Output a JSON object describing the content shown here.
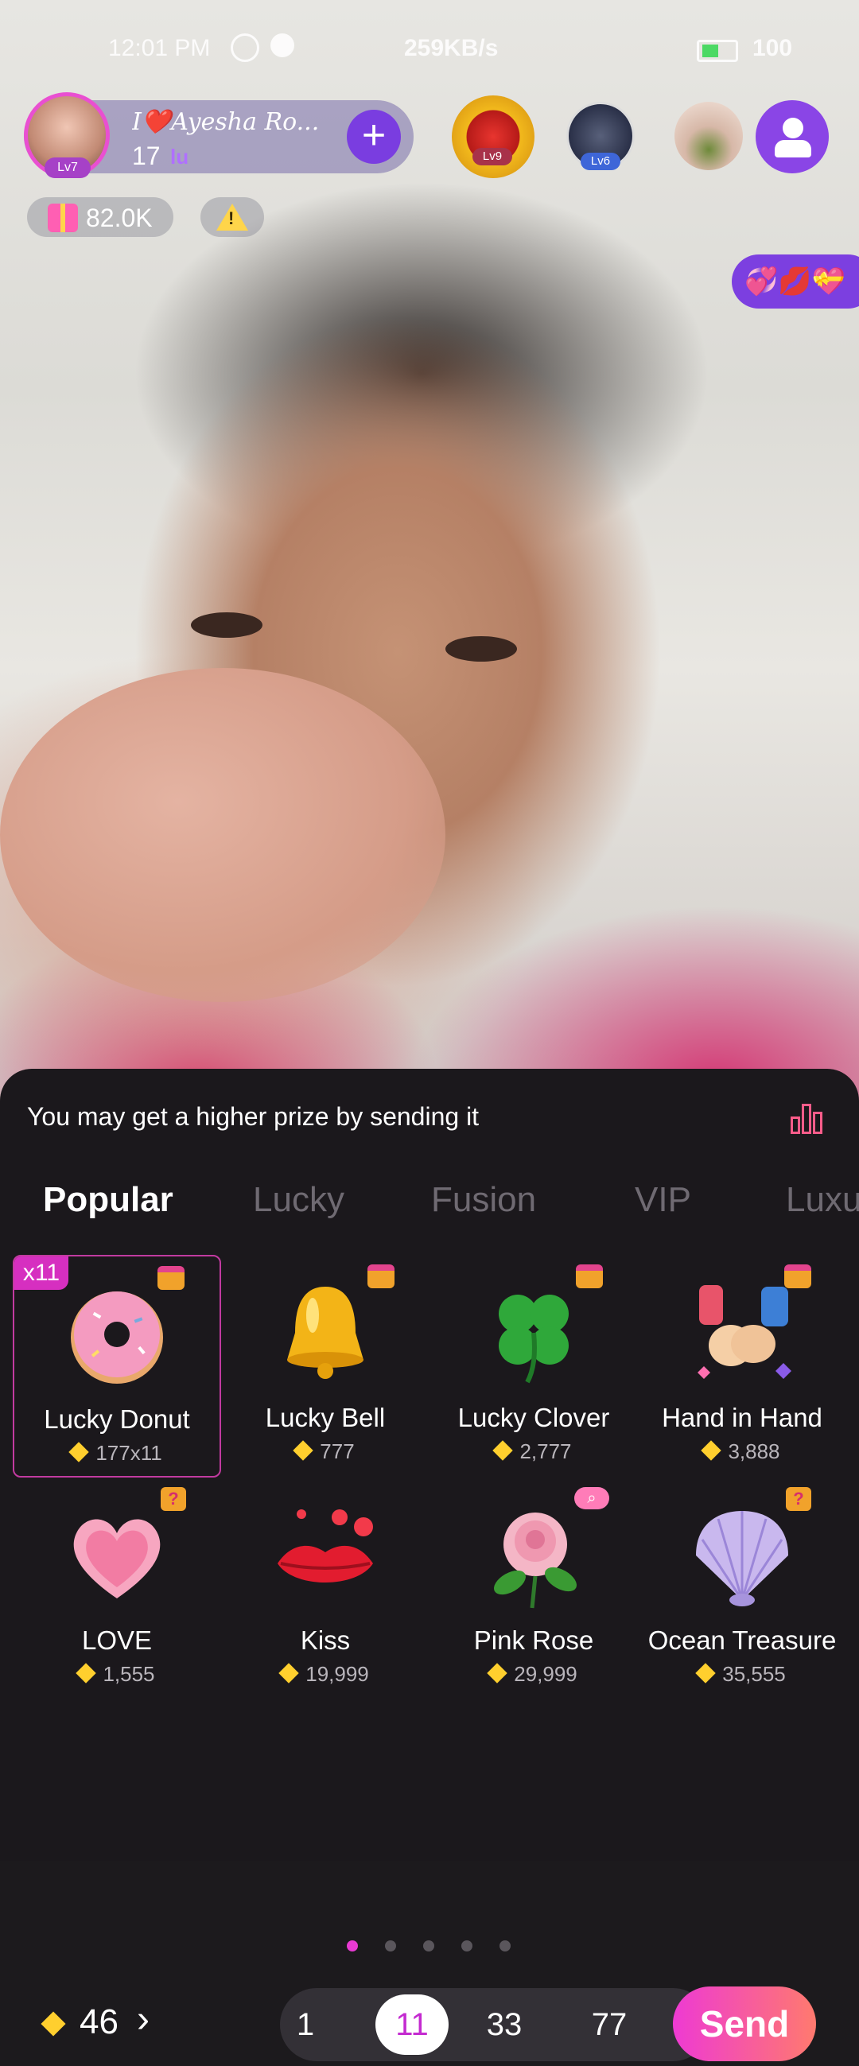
{
  "status_bar": {
    "time": "12:01 PM",
    "net_speed": "259KB/s",
    "battery": "100"
  },
  "host": {
    "name": "I❤️Ayesha Ro...",
    "level": "Lv7",
    "count": "17"
  },
  "viewers": [
    {
      "level": "Lv9"
    },
    {
      "level": "Lv6"
    },
    {
      "level": ""
    }
  ],
  "stats": {
    "gift_value": "82.0K"
  },
  "sticker_pill": {
    "icons": "💞💋💝"
  },
  "panel": {
    "tip": "You may get a higher prize by sending it",
    "tabs": [
      "Popular",
      "Lucky",
      "Fusion",
      "VIP",
      "Luxu"
    ],
    "gifts": [
      {
        "name": "Lucky Donut",
        "price": "177x11",
        "tag": "x11",
        "badge": "chest",
        "icon": "donut"
      },
      {
        "name": "Lucky Bell",
        "price": "777",
        "badge": "chest",
        "icon": "bell"
      },
      {
        "name": "Lucky Clover",
        "price": "2,777",
        "badge": "chest",
        "icon": "clover"
      },
      {
        "name": "Hand in Hand",
        "price": "3,888",
        "badge": "chest",
        "icon": "hands"
      },
      {
        "name": "LOVE",
        "price": "1,555",
        "badge": "question",
        "icon": "heart"
      },
      {
        "name": "Kiss",
        "price": "19,999",
        "badge": "",
        "icon": "lips"
      },
      {
        "name": "Pink Rose",
        "price": "29,999",
        "badge": "search",
        "icon": "rose"
      },
      {
        "name": "Ocean Treasure",
        "price": "35,555",
        "badge": "question",
        "icon": "shell"
      }
    ],
    "hint_mark": "?",
    "page_count": 5,
    "active_page": 1
  },
  "footer": {
    "balance": "46",
    "quantities": [
      "1",
      "11",
      "33",
      "77"
    ],
    "selected_quantity": "11",
    "send_label": "Send"
  },
  "colors": {
    "accent": "#e83ad2",
    "panel_bg": "#1b181c",
    "diamond": "#ffcf2e"
  }
}
